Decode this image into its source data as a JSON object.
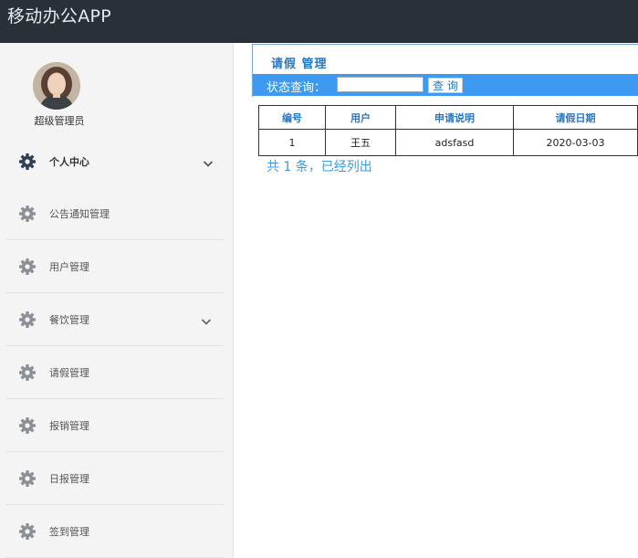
{
  "app": {
    "title": "移动办公APP"
  },
  "user": {
    "name": "超级管理员"
  },
  "sidebar": {
    "items": [
      {
        "label": "个人中心",
        "icon": "gear-icon",
        "has_submenu": true
      },
      {
        "label": "公告通知管理",
        "icon": "gear-icon",
        "has_submenu": false
      },
      {
        "label": "用户管理",
        "icon": "gear-icon",
        "has_submenu": false
      },
      {
        "label": "餐饮管理",
        "icon": "gear-icon",
        "has_submenu": true
      },
      {
        "label": "请假管理",
        "icon": "gear-icon",
        "has_submenu": false
      },
      {
        "label": "报销管理",
        "icon": "gear-icon",
        "has_submenu": false
      },
      {
        "label": "日报管理",
        "icon": "gear-icon",
        "has_submenu": false
      },
      {
        "label": "签到管理",
        "icon": "gear-icon",
        "has_submenu": false
      }
    ]
  },
  "main": {
    "title": "请假 管理",
    "search": {
      "label": "状态查询：",
      "value": "",
      "button_label": "查 询"
    },
    "table": {
      "headers": [
        "编号",
        "用户",
        "申请说明",
        "请假日期"
      ],
      "rows": [
        [
          "1",
          "王五",
          "adsfasd",
          "2020-03-03"
        ]
      ]
    },
    "summary": "共 1 条，已经列出"
  },
  "colors": {
    "topbar": "#2a3038",
    "accent": "#3d9af0",
    "link_text": "#2577c8"
  }
}
